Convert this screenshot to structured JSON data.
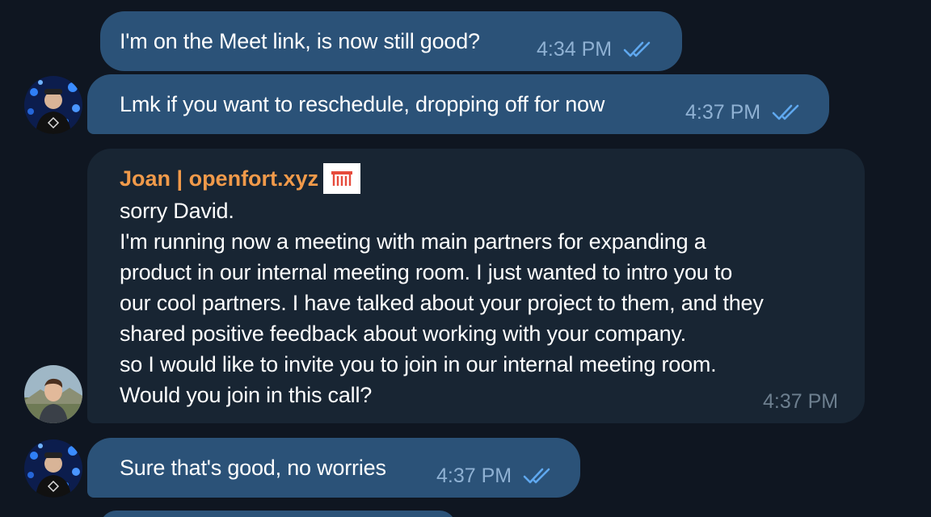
{
  "colors": {
    "background": "#0f1621",
    "outgoing_bubble": "#2b5278",
    "incoming_bubble": "#182533",
    "sender_name": "#f19a4a",
    "outgoing_time": "#8fb1d3",
    "incoming_time": "#6d7f8f",
    "read_ticks": "#5fa8ef"
  },
  "messages": [
    {
      "direction": "outgoing",
      "text": "I'm on the Meet link, is now still good?",
      "time": "4:34 PM",
      "status_icon": "double-check-icon"
    },
    {
      "direction": "outgoing",
      "text": "Lmk if you want to reschedule, dropping off for now",
      "time": "4:37 PM",
      "status_icon": "double-check-icon",
      "avatar": "user-avatar-david"
    },
    {
      "direction": "incoming",
      "sender": "Joan | openfort.xyz",
      "sender_badge_icon": "openfort-logo-icon",
      "text": "sorry David.\nI'm running now a meeting with main partners for expanding a\nproduct in our internal meeting room. I just wanted to intro you to\nour cool partners. I have talked about your project to them, and they\nshared positive feedback about working with your company.\nso I would like to invite you to join in our internal meeting room.\nWould you join in this call?",
      "time": "4:37 PM",
      "avatar": "user-avatar-joan"
    },
    {
      "direction": "outgoing",
      "text": "Sure that's good, no worries",
      "time": "4:37 PM",
      "status_icon": "double-check-icon",
      "avatar": "user-avatar-david"
    }
  ]
}
